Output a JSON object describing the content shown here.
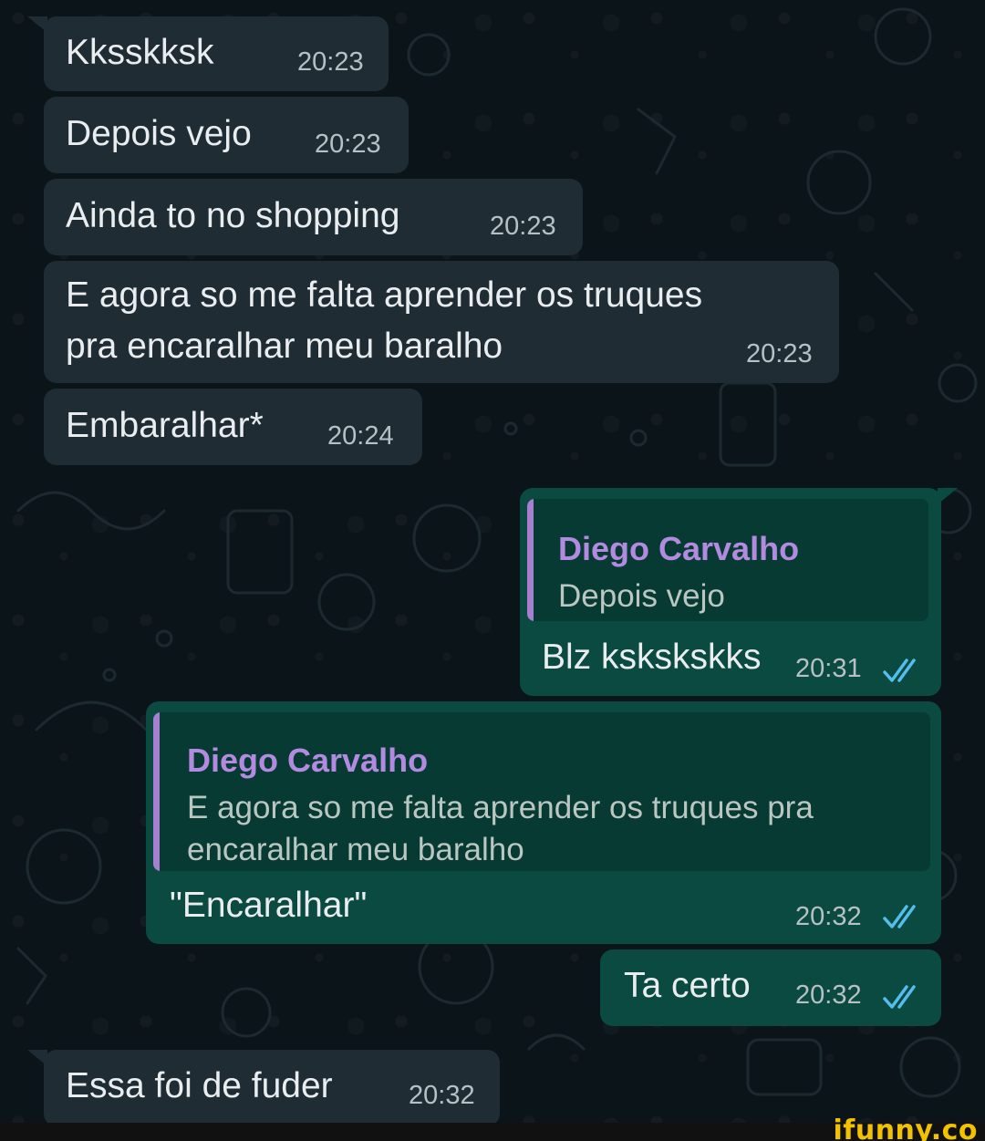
{
  "messages": [
    {
      "text": "Kksskksk",
      "time": "20:23"
    },
    {
      "text": "Depois vejo",
      "time": "20:23"
    },
    {
      "text": "Ainda to no shopping",
      "time": "20:23"
    },
    {
      "line1": "E agora so me falta aprender os truques",
      "line2": "pra encaralhar meu baralho",
      "time": "20:23"
    },
    {
      "text": "Embaralhar*",
      "time": "20:24"
    },
    {
      "quote_name": "Diego Carvalho",
      "quote_text": "Depois vejo",
      "text": "Blz kskskskks",
      "time": "20:31"
    },
    {
      "quote_name": "Diego Carvalho",
      "quote_line1": "E agora so me falta aprender os truques pra",
      "quote_line2": "encaralhar meu baralho",
      "text": "\"Encaralhar\"",
      "time": "20:32"
    },
    {
      "text": "Ta certo",
      "time": "20:32"
    },
    {
      "text": "Essa foi de fuder",
      "time": "20:32"
    }
  ],
  "icons": {
    "read_receipt": "double-check-icon"
  },
  "colors": {
    "incoming_bubble": "#1f2c34",
    "outgoing_bubble": "#0a4a40",
    "quote_name": "#b28be0",
    "read_ticks": "#53bdeb"
  },
  "watermark": "ifunny.co"
}
